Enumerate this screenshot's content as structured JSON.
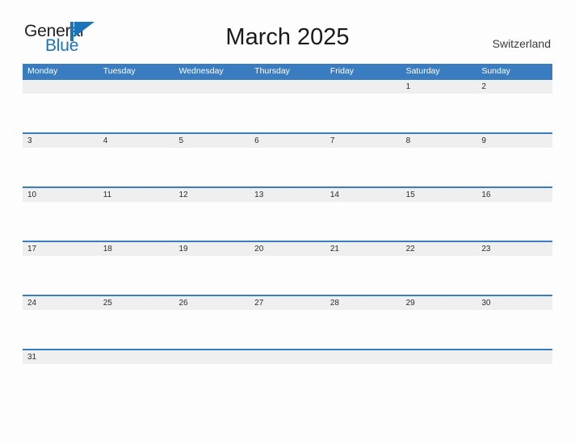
{
  "logo": {
    "word_one": "General",
    "word_two": "Blue",
    "mark": "flag-triangle-icon",
    "color_dark": "#231f20",
    "color_blue": "#1b73ba"
  },
  "header": {
    "title": "March 2025",
    "country": "Switzerland"
  },
  "colors": {
    "header_blue": "#3a7cc0",
    "row_divider_blue": "#3a7cc0",
    "day_band_gray": "#efefef",
    "page_background": "#fdfdfd",
    "day_number_text": "#2b2b2b",
    "weekday_text": "#ffffff"
  },
  "calendar": {
    "month": "March",
    "year": "2025",
    "weekday_headers": [
      "Monday",
      "Tuesday",
      "Wednesday",
      "Thursday",
      "Friday",
      "Saturday",
      "Sunday"
    ],
    "weeks": [
      {
        "days": [
          "",
          "",
          "",
          "",
          "",
          "1",
          "2"
        ]
      },
      {
        "days": [
          "3",
          "4",
          "5",
          "6",
          "7",
          "8",
          "9"
        ]
      },
      {
        "days": [
          "10",
          "11",
          "12",
          "13",
          "14",
          "15",
          "16"
        ]
      },
      {
        "days": [
          "17",
          "18",
          "19",
          "20",
          "21",
          "22",
          "23"
        ]
      },
      {
        "days": [
          "24",
          "25",
          "26",
          "27",
          "28",
          "29",
          "30"
        ]
      },
      {
        "days": [
          "31",
          "",
          "",
          "",
          "",
          "",
          ""
        ]
      }
    ]
  }
}
